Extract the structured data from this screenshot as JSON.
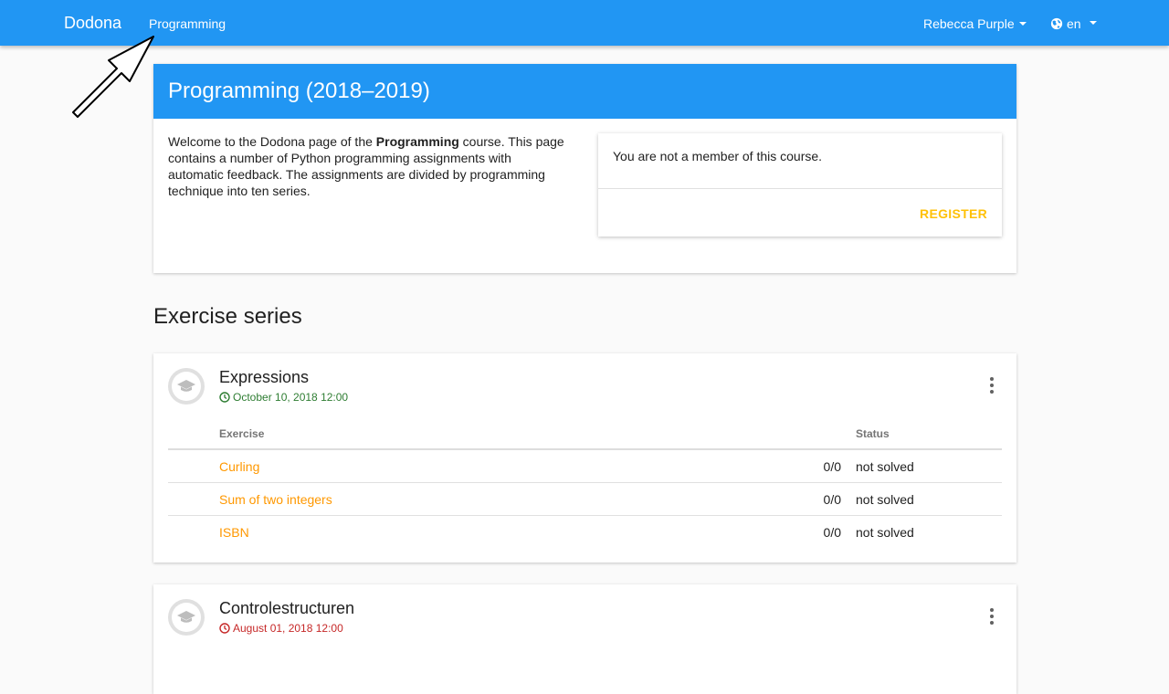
{
  "navbar": {
    "brand": "Dodona",
    "course_link": "Programming",
    "user": "Rebecca Purple",
    "language": "en"
  },
  "course": {
    "title": "Programming (2018–2019)",
    "description_before": "Welcome to the Dodona page of the ",
    "description_bold": "Programming",
    "description_after": " course. This page contains a number of Python programming assignments with automatic feedback. The assignments are divided by programming technique into ten series.",
    "membership_text": "You are not a member of this course.",
    "register_label": "REGISTER"
  },
  "section_title": "Exercise series",
  "series": [
    {
      "title": "Expressions",
      "deadline": "October 10, 2018 12:00",
      "deadline_color": "#2e7d32",
      "table_headers": {
        "exercise": "Exercise",
        "status": "Status"
      },
      "exercises": [
        {
          "name": "Curling",
          "score": "0/0",
          "status": "not solved"
        },
        {
          "name": "Sum of two integers",
          "score": "0/0",
          "status": "not solved"
        },
        {
          "name": "ISBN",
          "score": "0/0",
          "status": "not solved"
        }
      ]
    },
    {
      "title": "Controlestructuren",
      "deadline": "August 01, 2018 12:00",
      "deadline_color": "#c62828"
    }
  ],
  "colors": {
    "primary": "#2196f3",
    "accent": "#ffc107",
    "exercise_link": "#ff9800"
  },
  "icons": [
    "globe-icon",
    "caret-down-icon",
    "graduation-cap-icon",
    "clock-icon",
    "more-vert-icon",
    "annotation-arrow"
  ]
}
